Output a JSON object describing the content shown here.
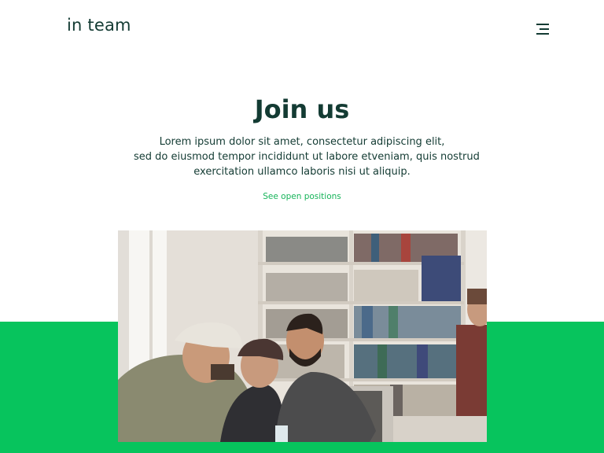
{
  "brand": {
    "name": "in team"
  },
  "header": {
    "menu_icon": "hamburger-menu-icon"
  },
  "hero": {
    "title": "Join us",
    "description_lines": [
      "Lorem ipsum dolor sit amet, consectetur adipiscing elit,",
      "sed do eiusmod tempor incididunt ut labore etveniam, quis nostrud",
      "exercitation ullamco laboris nisi ut aliquip."
    ],
    "cta_label": "See open positions"
  },
  "colors": {
    "accent_green": "#07c45d",
    "link_green": "#17b45a",
    "text_dark": "#133b33"
  }
}
